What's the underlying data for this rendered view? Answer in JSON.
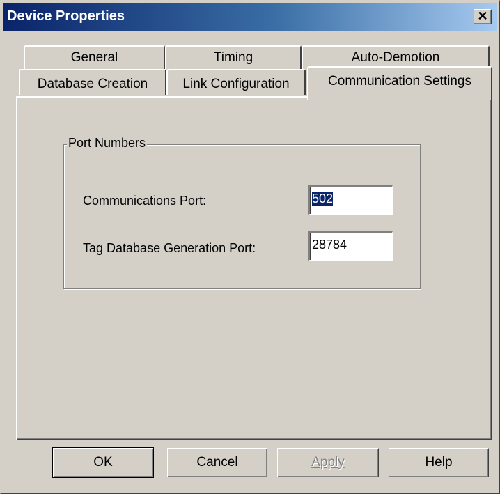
{
  "window": {
    "title": "Device Properties",
    "close_glyph": "✕"
  },
  "tabs": {
    "row1": [
      "General",
      "Timing",
      "Auto-Demotion"
    ],
    "row2": [
      "Database Creation",
      "Link Configuration",
      "Communication Settings"
    ],
    "active": "Communication Settings"
  },
  "group": {
    "legend": "Port Numbers",
    "comm_port_label": "Communications Port:",
    "comm_port_value": "502",
    "tagdb_port_label": "Tag Database Generation Port:",
    "tagdb_port_value": "28784"
  },
  "buttons": {
    "ok": "OK",
    "cancel": "Cancel",
    "apply": "Apply",
    "help": "Help"
  }
}
